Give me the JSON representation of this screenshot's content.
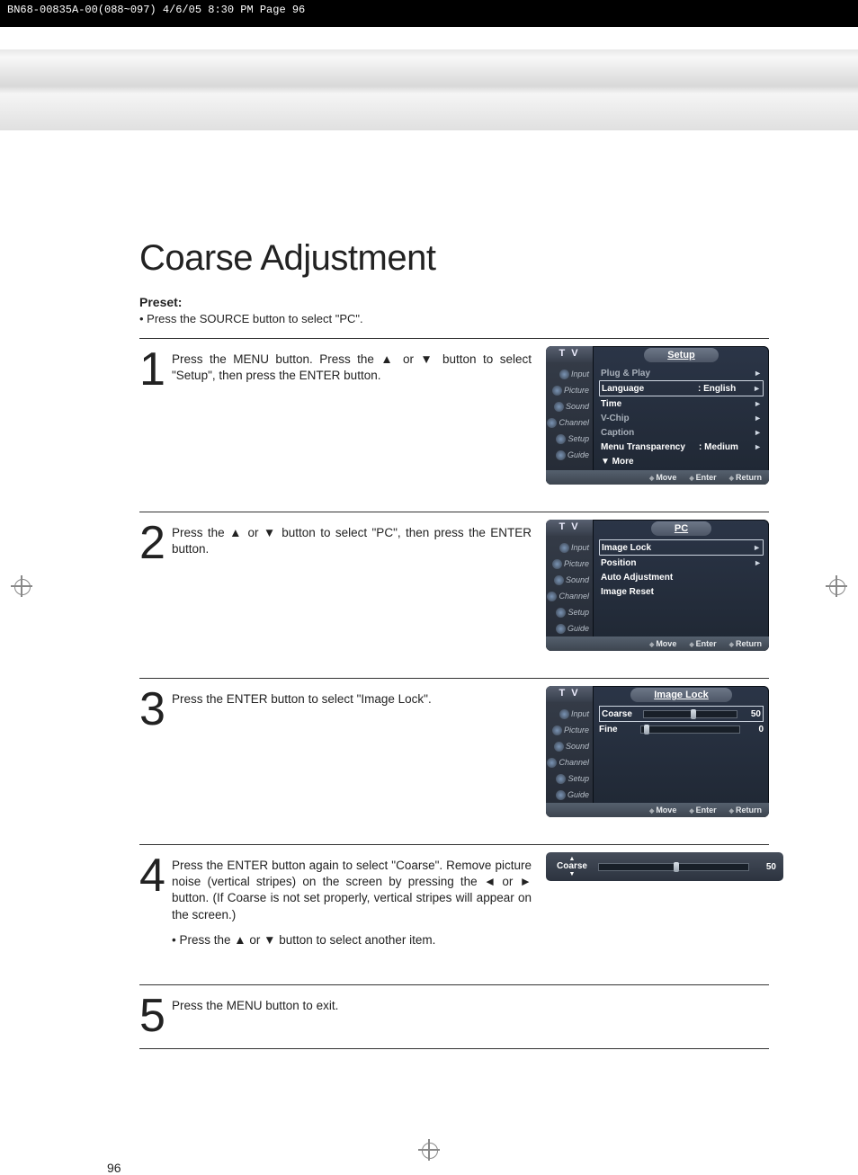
{
  "print_header": "BN68-00835A-00(088~097)  4/6/05  8:30 PM  Page 96",
  "title": "Coarse Adjustment",
  "preset_label": "Preset:",
  "preset_bullet": "•   Press the SOURCE button to select \"PC\".",
  "page_number": "96",
  "footer": {
    "move": "Move",
    "enter": "Enter",
    "ret": "Return"
  },
  "osd_side": [
    "Input",
    "Picture",
    "Sound",
    "Channel",
    "Setup",
    "Guide"
  ],
  "tv_label": "T V",
  "steps": {
    "s1": {
      "num": "1",
      "text": "Press the MENU button. Press the ▲ or ▼ button to select \"Setup\", then press the ENTER button.",
      "osd_title": "Setup",
      "menu": [
        {
          "label": "Plug & Play",
          "val": "",
          "arrow": "►",
          "style": "dim"
        },
        {
          "label": "Language",
          "val": ": English",
          "arrow": "►",
          "style": "boxed"
        },
        {
          "label": "Time",
          "val": "",
          "arrow": "►",
          "style": "bold"
        },
        {
          "label": "V-Chip",
          "val": "",
          "arrow": "►",
          "style": "dim"
        },
        {
          "label": "Caption",
          "val": "",
          "arrow": "►",
          "style": "dim"
        },
        {
          "label": "Menu Transparency",
          "val": ": Medium",
          "arrow": "►",
          "style": "bold"
        },
        {
          "label": "▼ More",
          "val": "",
          "arrow": "",
          "style": "bold"
        }
      ]
    },
    "s2": {
      "num": "2",
      "text": "Press the ▲ or ▼ button to select \"PC\", then press the ENTER button.",
      "osd_title": "PC",
      "menu": [
        {
          "label": "Image Lock",
          "val": "",
          "arrow": "►",
          "style": "boxed"
        },
        {
          "label": "Position",
          "val": "",
          "arrow": "►",
          "style": "bold"
        },
        {
          "label": "Auto Adjustment",
          "val": "",
          "arrow": "",
          "style": "bold"
        },
        {
          "label": "Image Reset",
          "val": "",
          "arrow": "",
          "style": "bold"
        }
      ]
    },
    "s3": {
      "num": "3",
      "text": "Press the ENTER button to select \"Image Lock\".",
      "osd_title": "Image Lock",
      "sliders": [
        {
          "label": "Coarse",
          "value": "50",
          "pos": 50,
          "boxed": true
        },
        {
          "label": "Fine",
          "value": "0",
          "pos": 3,
          "boxed": false
        }
      ]
    },
    "s4": {
      "num": "4",
      "text": "Press the ENTER button again to select \"Coarse\". Remove picture noise (vertical stripes) on the screen by pressing the ◄ or ► button. (If Coarse is not set properly, vertical stripes will appear on the screen.)",
      "bullet": "•  Press the ▲ or ▼ button to select another item.",
      "bar": {
        "label": "Coarse",
        "value": "50",
        "pos": 50
      }
    },
    "s5": {
      "num": "5",
      "text": "Press the MENU button to exit."
    }
  }
}
